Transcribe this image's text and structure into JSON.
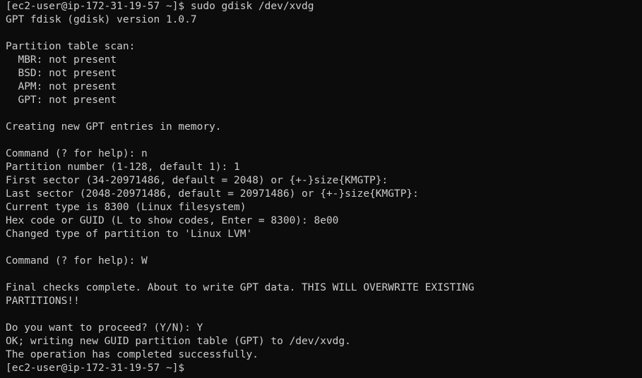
{
  "terminal": {
    "lines": [
      "[ec2-user@ip-172-31-19-57 ~]$ sudo gdisk /dev/xvdg",
      "GPT fdisk (gdisk) version 1.0.7",
      "",
      "Partition table scan:",
      "  MBR: not present",
      "  BSD: not present",
      "  APM: not present",
      "  GPT: not present",
      "",
      "Creating new GPT entries in memory.",
      "",
      "Command (? for help): n",
      "Partition number (1-128, default 1): 1",
      "First sector (34-20971486, default = 2048) or {+-}size{KMGTP}:",
      "Last sector (2048-20971486, default = 20971486) or {+-}size{KMGTP}:",
      "Current type is 8300 (Linux filesystem)",
      "Hex code or GUID (L to show codes, Enter = 8300): 8e00",
      "Changed type of partition to 'Linux LVM'",
      "",
      "Command (? for help): W",
      "",
      "Final checks complete. About to write GPT data. THIS WILL OVERWRITE EXISTING",
      "PARTITIONS!!",
      "",
      "Do you want to proceed? (Y/N): Y",
      "OK; writing new GUID partition table (GPT) to /dev/xvdg.",
      "The operation has completed successfully.",
      "[ec2-user@ip-172-31-19-57 ~]$"
    ]
  },
  "colors": {
    "background": "#0c0c0c",
    "text": "#cccccc"
  }
}
